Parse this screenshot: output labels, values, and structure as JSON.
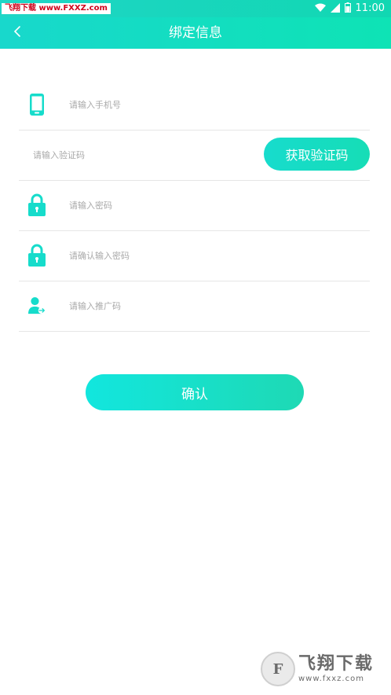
{
  "status_bar": {
    "watermark": "飞翔下载 www.FXXZ.com",
    "time": "11:00",
    "icons": [
      "wifi-icon",
      "signal-icon",
      "battery-icon"
    ]
  },
  "header": {
    "back_icon": "chevron-left-icon",
    "title": "绑定信息"
  },
  "form": {
    "phone": {
      "icon": "phone-icon",
      "placeholder": "请输入手机号",
      "value": ""
    },
    "code": {
      "placeholder": "请输入验证码",
      "value": "",
      "button_label": "获取验证码"
    },
    "password": {
      "icon": "lock-icon",
      "placeholder": "请输入密码",
      "value": ""
    },
    "confirm_password": {
      "icon": "lock-icon",
      "placeholder": "请确认输入密码",
      "value": ""
    },
    "referral": {
      "icon": "user-share-icon",
      "placeholder": "请输入推广码",
      "value": ""
    }
  },
  "confirm_label": "确认",
  "logo": {
    "title": "飞翔下载",
    "url": "www.fxxz.com"
  },
  "colors": {
    "accent": "#16dccb",
    "accent_end": "#11deb4",
    "placeholder": "#a9a9a9",
    "divider": "#e6e6e6"
  }
}
